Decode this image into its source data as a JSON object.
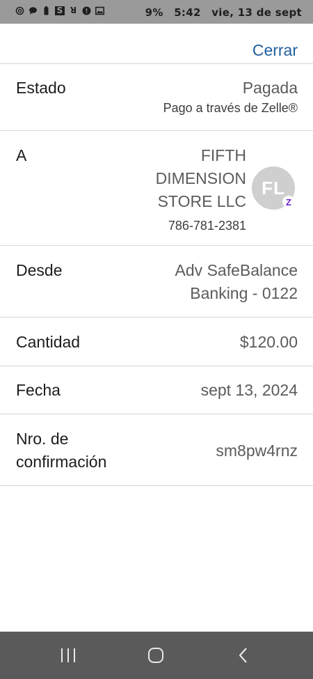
{
  "status_bar": {
    "battery": "9%",
    "time": "5:42",
    "date": "vie, 13 de sept",
    "icons": [
      "threads-icon",
      "chat-icon",
      "battery-alert-icon",
      "s-app-icon",
      "r-icon",
      "alert-icon",
      "gallery-icon"
    ]
  },
  "header": {
    "close_label": "Cerrar"
  },
  "details": {
    "status": {
      "label": "Estado",
      "value": "Pagada",
      "note": "Pago a través de Zelle®"
    },
    "to": {
      "label": "A",
      "name_line1": "FIFTH",
      "name_line2": "DIMENSION",
      "name_line3": "STORE LLC",
      "phone": "786-781-2381",
      "avatar_initials": "FL",
      "badge": "Z"
    },
    "from": {
      "label": "Desde",
      "value_line1": "Adv SafeBalance",
      "value_line2": "Banking - 0122"
    },
    "amount": {
      "label": "Cantidad",
      "value": "$120.00"
    },
    "date": {
      "label": "Fecha",
      "value": "sept 13, 2024"
    },
    "confirmation": {
      "label_line1": "Nro. de",
      "label_line2": "confirmación",
      "value": "sm8pw4rnz"
    }
  },
  "nav": [
    "recents-icon",
    "home-icon",
    "back-icon"
  ]
}
